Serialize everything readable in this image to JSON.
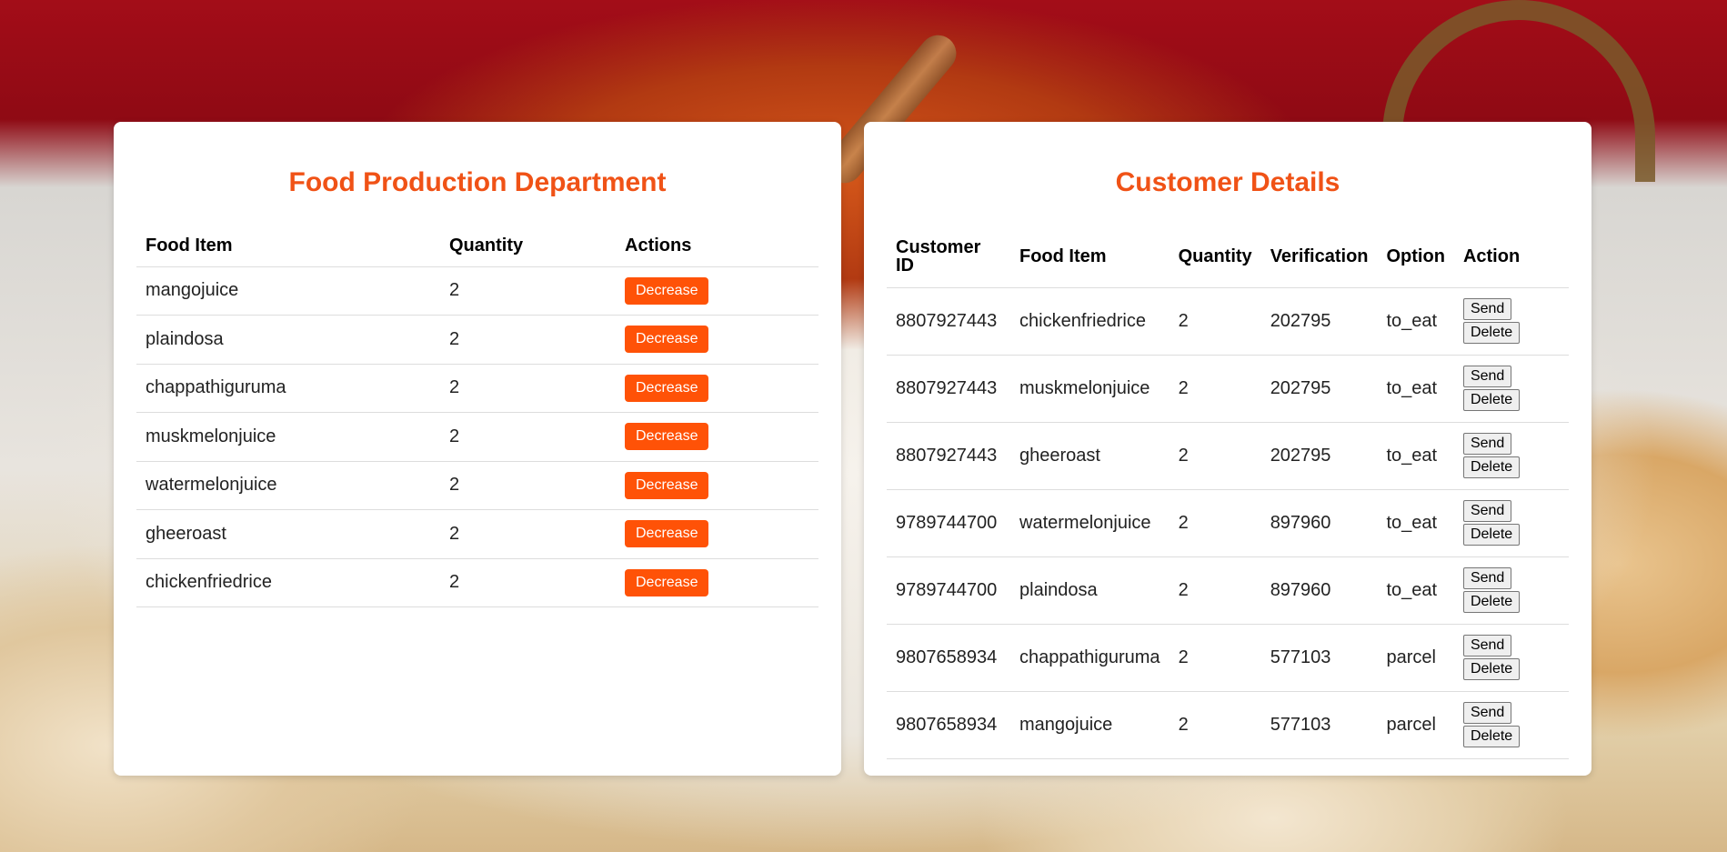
{
  "production": {
    "title": "Food Production Department",
    "columns": [
      "Food Item",
      "Quantity",
      "Actions"
    ],
    "rows": [
      {
        "item": "mangojuice",
        "qty": "2"
      },
      {
        "item": "plaindosa",
        "qty": "2"
      },
      {
        "item": "chappathiguruma",
        "qty": "2"
      },
      {
        "item": "muskmelonjuice",
        "qty": "2"
      },
      {
        "item": "watermelonjuice",
        "qty": "2"
      },
      {
        "item": "gheeroast",
        "qty": "2"
      },
      {
        "item": "chickenfriedrice",
        "qty": "2"
      }
    ],
    "decrease_label": "Decrease",
    "accent": "#f05216",
    "button_color": "#ff5207"
  },
  "customers": {
    "title": "Customer Details",
    "columns": [
      "Customer ID",
      "Food Item",
      "Quantity",
      "Verification",
      "Option",
      "Action"
    ],
    "rows": [
      {
        "id": "8807927443",
        "item": "chickenfriedrice",
        "qty": "2",
        "verification": "202795",
        "option": "to_eat"
      },
      {
        "id": "8807927443",
        "item": "muskmelonjuice",
        "qty": "2",
        "verification": "202795",
        "option": "to_eat"
      },
      {
        "id": "8807927443",
        "item": "gheeroast",
        "qty": "2",
        "verification": "202795",
        "option": "to_eat"
      },
      {
        "id": "9789744700",
        "item": "watermelonjuice",
        "qty": "2",
        "verification": "897960",
        "option": "to_eat"
      },
      {
        "id": "9789744700",
        "item": "plaindosa",
        "qty": "2",
        "verification": "897960",
        "option": "to_eat"
      },
      {
        "id": "9807658934",
        "item": "chappathiguruma",
        "qty": "2",
        "verification": "577103",
        "option": "parcel"
      },
      {
        "id": "9807658934",
        "item": "mangojuice",
        "qty": "2",
        "verification": "577103",
        "option": "parcel"
      }
    ],
    "send_label": "Send",
    "delete_label": "Delete"
  }
}
